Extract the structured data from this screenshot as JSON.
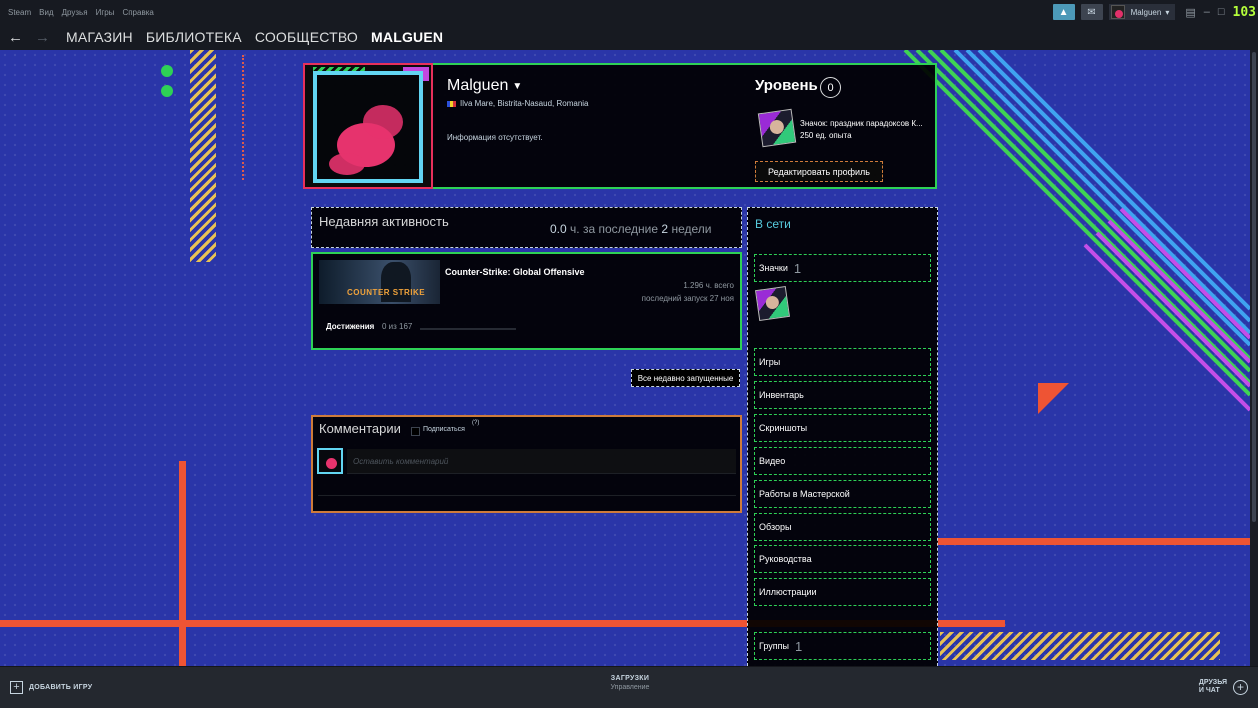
{
  "menu": [
    "Steam",
    "Вид",
    "Друзья",
    "Игры",
    "Справка"
  ],
  "tray": {
    "account_name": "Malguen",
    "fps": "103"
  },
  "nav": {
    "items": [
      "МАГАЗИН",
      "БИБЛИОТЕКА",
      "СООБЩЕСТВО",
      "MALGUEN"
    ],
    "active": "MALGUEN"
  },
  "profile": {
    "name": "Malguen",
    "location": "Ilva Mare, Bistrita-Nasaud, Romania",
    "info": "Информация отсутствует.",
    "level_label": "Уровень",
    "level": "0",
    "badge_title": "Значок: праздник парадоксов К...",
    "badge_xp": "250 ед. опыта",
    "edit_button": "Редактировать профиль"
  },
  "activity": {
    "title": "Недавняя активность",
    "hours_value": "0.0",
    "hours_mid": "ч. за последние",
    "weeks": "2",
    "weeks_suffix": "недели"
  },
  "game": {
    "name": "Counter-Strike: Global Offensive",
    "capsule_logo": "COUNTER STRIKE",
    "hours_total": "1.296 ч. всего",
    "last_played": "последний запуск 27 ноя",
    "achievements_label": "Достижения",
    "achievements_value": "0 из 167"
  },
  "all_recent_button": "Все недавно запущенные",
  "comments": {
    "title": "Комментарии",
    "subscribe_label": "Подписаться",
    "help_mark": "(?)",
    "placeholder": "Оставить комментарий"
  },
  "sidebar": {
    "status": "В сети",
    "badges_label": "Значки",
    "badges_count": "1",
    "links": [
      "Игры",
      "Инвентарь",
      "Скриншоты",
      "Видео",
      "Работы в Мастерской",
      "Обзоры",
      "Руководства",
      "Иллюстрации"
    ],
    "groups_label": "Группы",
    "groups_count": "1"
  },
  "bottom": {
    "add_game": "ДОБАВИТЬ ИГРУ",
    "downloads_title": "ЗАГРУЗКИ",
    "downloads_sub": "Управление",
    "friends_line1": "ДРУЗЬЯ",
    "friends_line2": "И ЧАТ"
  },
  "colors": {
    "background": "#2a35a8",
    "accent_green": "#2ed156",
    "accent_orange": "#ce7b3a",
    "status_online": "#57cbde"
  }
}
